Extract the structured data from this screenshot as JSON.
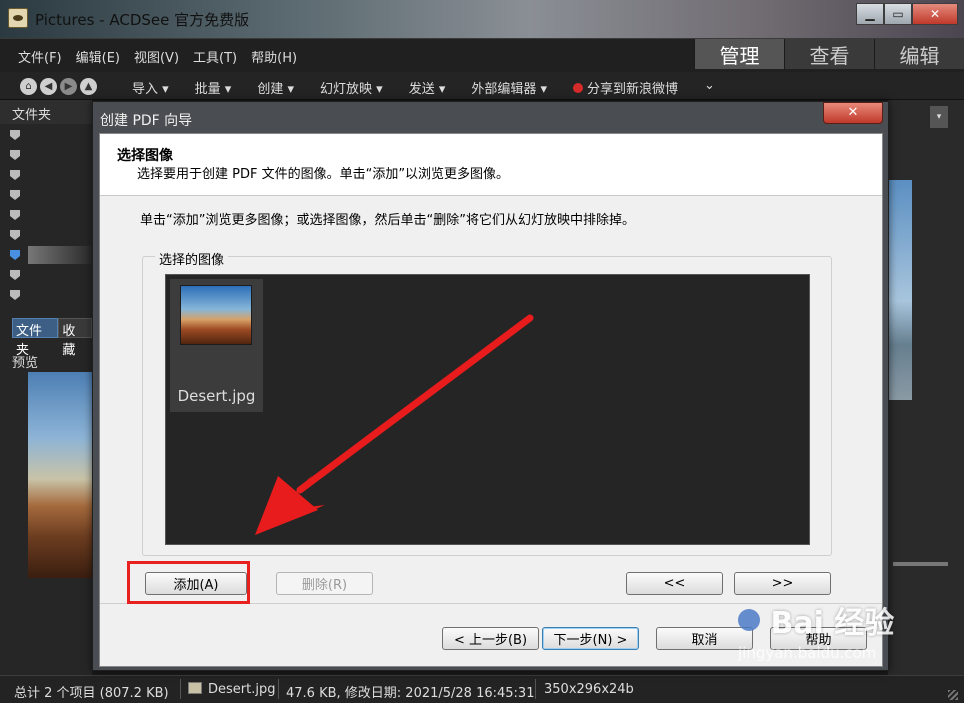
{
  "window": {
    "title": "Pictures - ACDSee 官方免费版",
    "controls": {
      "minimize": "▁",
      "maximize": "▭",
      "close": "✕"
    }
  },
  "menu": [
    "文件(F)",
    "编辑(E)",
    "视图(V)",
    "工具(T)",
    "帮助(H)"
  ],
  "modes": [
    "管理",
    "查看",
    "编辑"
  ],
  "toolbar": {
    "nav": [
      "⌂",
      "◀",
      "▶",
      "▲"
    ],
    "items": [
      "导入 ▾",
      "批量 ▾",
      "创建 ▾",
      "幻灯放映 ▾",
      "发送 ▾",
      "外部编辑器 ▾",
      "分享到新浪微博"
    ],
    "more": "⌄"
  },
  "left_panel": {
    "header": "文件夹",
    "tabs": [
      "文件夹",
      "收藏"
    ],
    "preview_label": "预览"
  },
  "right_panel": {
    "dropdown_icon": "▾",
    "sort_icon": "▾",
    "zoom_icon": "+"
  },
  "status": {
    "total": "总计 2 个项目 (807.2 KB)",
    "file": "Desert.jpg",
    "info": "47.6 KB, 修改日期: 2021/5/28 16:45:31",
    "dims": "350x296x24b"
  },
  "dialog": {
    "title": "创建 PDF 向导",
    "close": "✕",
    "heading": "选择图像",
    "subheading": "选择要用于创建 PDF 文件的图像。单击“添加”以浏览更多图像。",
    "instruction": "单击“添加”浏览更多图像；或选择图像，然后单击“删除”将它们从幻灯放映中排除掉。",
    "group_label": "选择的图像",
    "images": [
      {
        "name": "Desert.jpg"
      }
    ],
    "buttons": {
      "add": "添加(A)",
      "remove": "删除(R)",
      "move_left": "<<",
      "move_right": ">>",
      "back": "< 上一步(B)",
      "next": "下一步(N) >",
      "cancel": "取消",
      "help": "帮助"
    }
  },
  "annotation": {
    "arrow_color": "#e81c1c",
    "box_color": "#e82020"
  },
  "watermark": {
    "logo": "Bai 经验",
    "url": "jingyan.baidu.com"
  }
}
